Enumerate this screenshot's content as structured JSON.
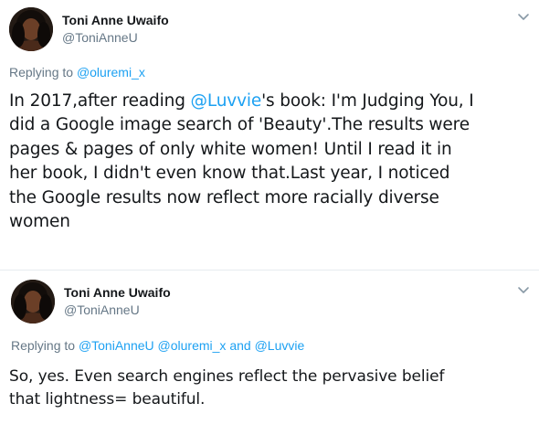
{
  "colors": {
    "text": "#14171a",
    "secondary": "#657786",
    "link": "#1da1f2",
    "divider": "#e6ecf0"
  },
  "tweets": [
    {
      "author": {
        "name": "Toni Anne Uwaifo",
        "handle": "@ToniAnneU",
        "avatar_icon": "profile-photo-avatar"
      },
      "menu_icon": "chevron-down-icon",
      "replying_to": {
        "prefix": "Replying to",
        "mentions": [
          "@oluremi_x"
        ]
      },
      "lines": [
        {
          "before": "In 2017,after reading ",
          "mention": "@Luvvie",
          "after": "'s book: I'm Judging You, I"
        },
        {
          "text": "did a Google image search of 'Beauty'.The results were"
        },
        {
          "text": "pages & pages of only white women! Until I read it in"
        },
        {
          "text": "her book, I didn't even know that.Last year, I noticed"
        },
        {
          "text": "the Google results now reflect more racially diverse"
        },
        {
          "text": "women"
        }
      ]
    },
    {
      "author": {
        "name": "Toni Anne Uwaifo",
        "handle": "@ToniAnneU",
        "avatar_icon": "profile-photo-avatar"
      },
      "menu_icon": "chevron-down-icon",
      "replying_to": {
        "prefix": "Replying to",
        "mentions": [
          "@ToniAnneU",
          "@oluremi_x"
        ],
        "conjunction": "and",
        "last_mention": "@Luvvie"
      },
      "lines": [
        {
          "text": "So, yes. Even search engines reflect the pervasive belief"
        },
        {
          "text": "that lightness= beautiful."
        }
      ]
    }
  ]
}
